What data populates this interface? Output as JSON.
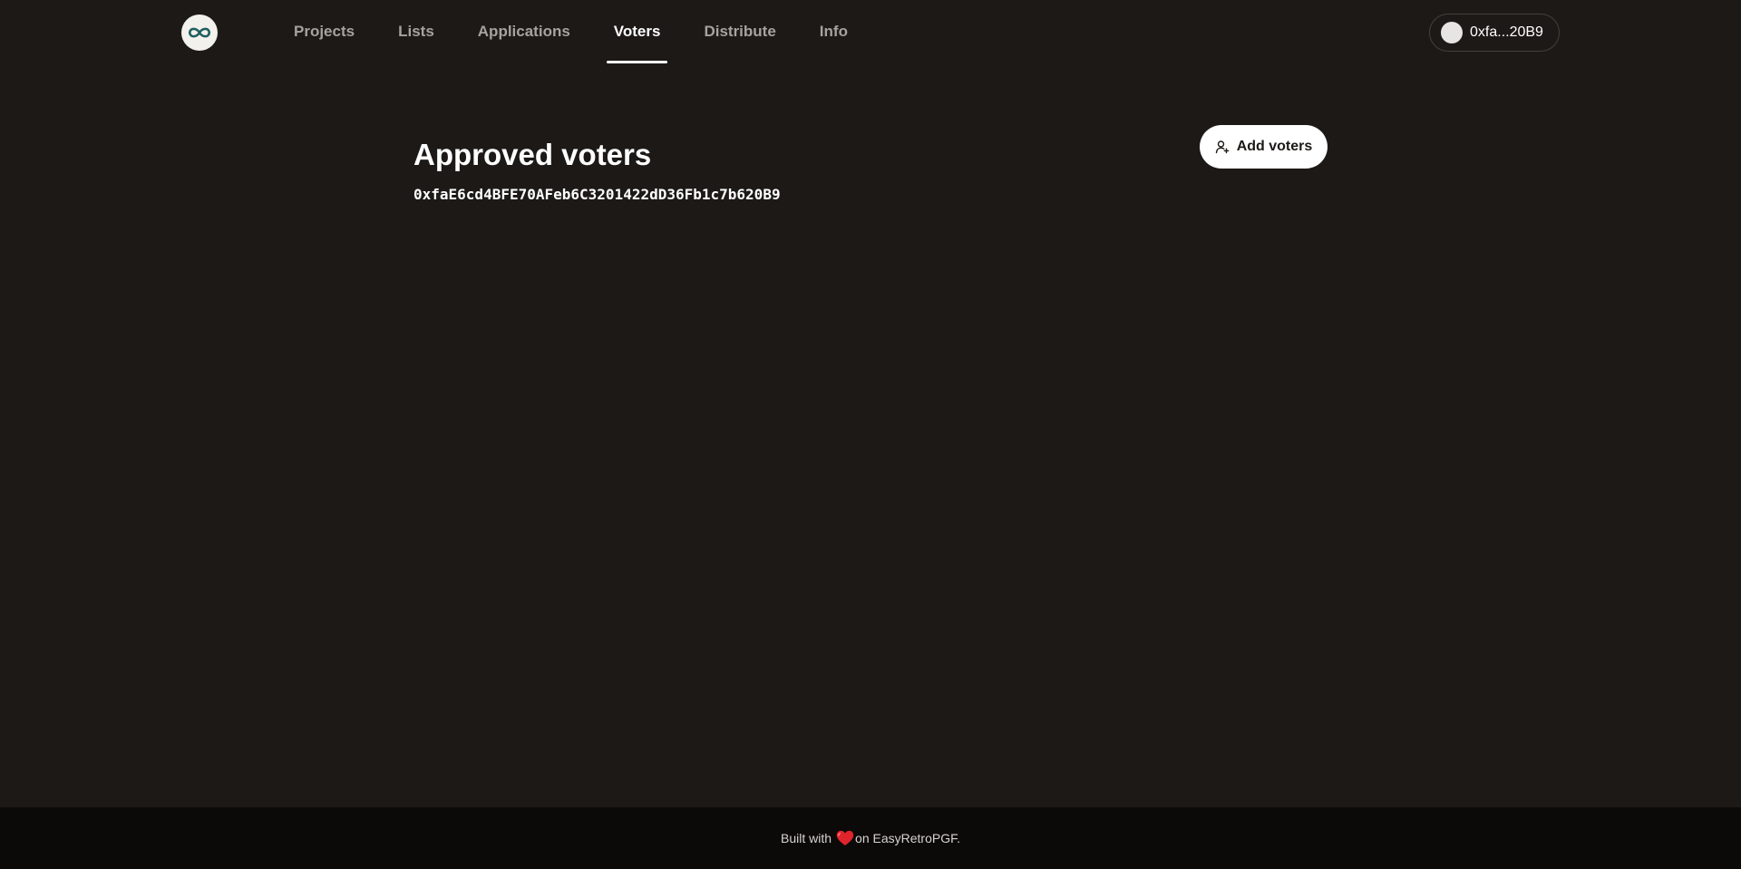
{
  "header": {
    "logo_icon": "infinity-icon",
    "nav": [
      {
        "label": "Projects",
        "active": false
      },
      {
        "label": "Lists",
        "active": false
      },
      {
        "label": "Applications",
        "active": false
      },
      {
        "label": "Voters",
        "active": true
      },
      {
        "label": "Distribute",
        "active": false
      },
      {
        "label": "Info",
        "active": false
      }
    ],
    "account": {
      "address_short": "0xfa...20B9",
      "avatar_icon": "avatar-circle"
    }
  },
  "main": {
    "title": "Approved voters",
    "add_button": {
      "label": "Add voters",
      "icon": "user-plus-icon"
    },
    "voters": [
      "0xfaE6cd4BFE70AFeb6C3201422dD36Fb1c7b620B9"
    ]
  },
  "footer": {
    "prefix": "Built with",
    "heart_icon": "heart-icon",
    "suffix": "on EasyRetroPGF."
  },
  "colors": {
    "background": "#1c1917",
    "footer_background": "#0c0a09",
    "accent": "#ffffff",
    "muted_text": "#a8a29e",
    "logo_stroke": "#1f5e60",
    "heart": "#e0242b"
  }
}
